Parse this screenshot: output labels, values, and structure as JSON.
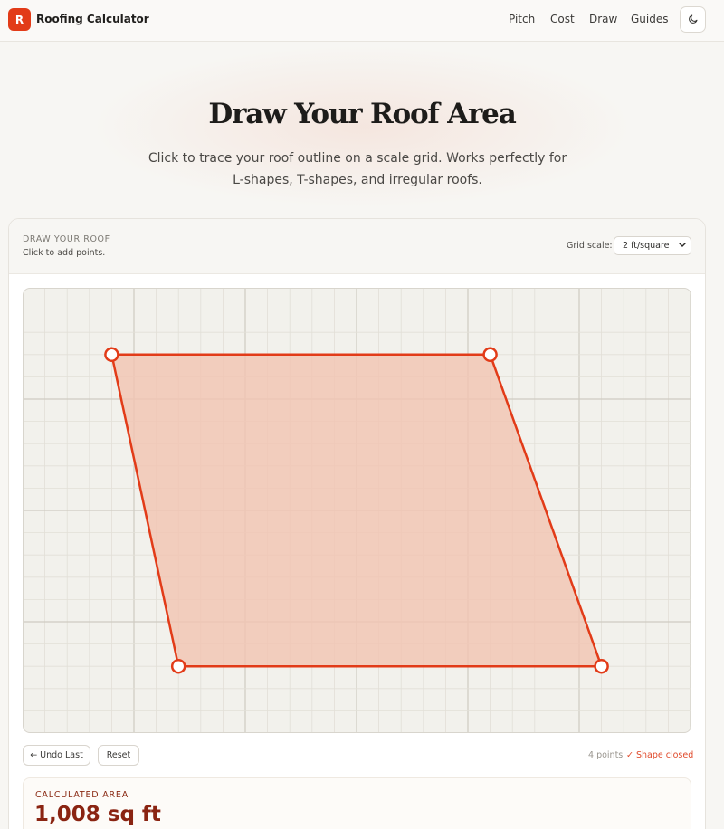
{
  "app": {
    "logo_letter": "R",
    "brand": "Roofing Calculator",
    "accent": "#e23b18"
  },
  "nav": {
    "links": [
      "Pitch",
      "Cost",
      "Draw",
      "Guides"
    ],
    "theme_icon": "moon-icon"
  },
  "hero": {
    "title": "Draw Your Roof Area",
    "subtitle": "Click to trace your roof outline on a scale grid. Works perfectly for L-shapes, T-shapes, and irregular roofs."
  },
  "draw_card": {
    "label": "DRAW YOUR ROOF",
    "hint": "Click to add points.",
    "scale_label": "Grid scale:",
    "scale_value": "2 ft/square",
    "polygon_points_grid": [
      [
        4,
        3
      ],
      [
        21,
        3
      ],
      [
        26,
        17
      ],
      [
        7,
        17
      ]
    ],
    "fill_color": "#f2c4b2",
    "stroke_color": "#e23b18"
  },
  "controls": {
    "undo": "← Undo Last",
    "reset": "Reset",
    "points_count": "4 points",
    "status": "✓ Shape closed"
  },
  "result": {
    "label": "CALCULATED AREA",
    "value": "1,008 sq ft"
  }
}
